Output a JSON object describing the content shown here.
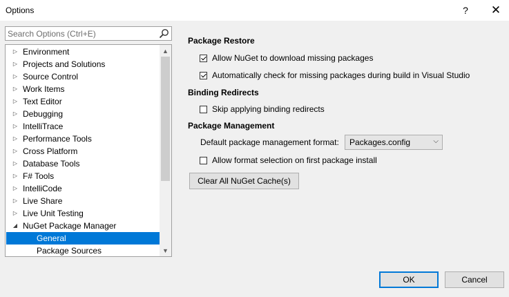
{
  "window": {
    "title": "Options",
    "help_label": "?",
    "close_label": "✕"
  },
  "search": {
    "placeholder": "Search Options (Ctrl+E)",
    "icon": "search-icon"
  },
  "tree": {
    "items": [
      {
        "label": "Environment",
        "expanded": false
      },
      {
        "label": "Projects and Solutions",
        "expanded": false
      },
      {
        "label": "Source Control",
        "expanded": false
      },
      {
        "label": "Work Items",
        "expanded": false
      },
      {
        "label": "Text Editor",
        "expanded": false
      },
      {
        "label": "Debugging",
        "expanded": false
      },
      {
        "label": "IntelliTrace",
        "expanded": false
      },
      {
        "label": "Performance Tools",
        "expanded": false
      },
      {
        "label": "Cross Platform",
        "expanded": false
      },
      {
        "label": "Database Tools",
        "expanded": false
      },
      {
        "label": "F# Tools",
        "expanded": false
      },
      {
        "label": "IntelliCode",
        "expanded": false
      },
      {
        "label": "Live Share",
        "expanded": false
      },
      {
        "label": "Live Unit Testing",
        "expanded": false
      },
      {
        "label": "NuGet Package Manager",
        "expanded": true
      },
      {
        "label": "General",
        "child": true,
        "selected": true
      },
      {
        "label": "Package Sources",
        "child": true
      }
    ]
  },
  "package_restore": {
    "heading": "Package Restore",
    "allow_download": {
      "label": "Allow NuGet to download missing packages",
      "checked": true
    },
    "auto_check": {
      "label": "Automatically check for missing packages during build in Visual Studio",
      "checked": true
    }
  },
  "binding_redirects": {
    "heading": "Binding Redirects",
    "skip": {
      "label": "Skip applying binding redirects",
      "checked": false
    }
  },
  "package_management": {
    "heading": "Package Management",
    "format_label": "Default package management format:",
    "format_value": "Packages.config",
    "allow_format_selection": {
      "label": "Allow format selection on first package install",
      "checked": false
    },
    "clear_cache_label": "Clear All NuGet Cache(s)"
  },
  "footer": {
    "ok_label": "OK",
    "cancel_label": "Cancel"
  },
  "colors": {
    "selection": "#0078d7",
    "window_bg": "#f0f0f0"
  }
}
